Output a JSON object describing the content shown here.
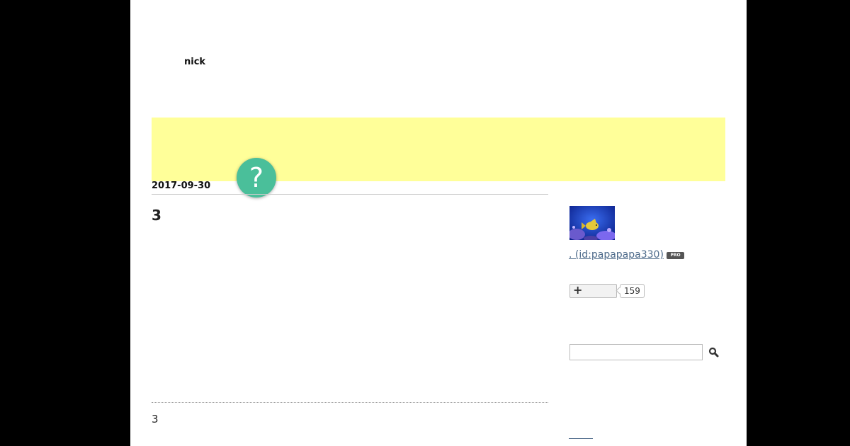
{
  "blog": {
    "title": "nick"
  },
  "help": {
    "glyph": "?"
  },
  "entry": {
    "date": "2017-09-30",
    "title": "3",
    "footer_text": "3"
  },
  "sidebar": {
    "profile": {
      "name_link": ". (id:papapapa330)",
      "badge": "PRO"
    },
    "follow": {
      "plus": "+",
      "count": "159"
    },
    "search": {
      "placeholder": ""
    }
  },
  "colors": {
    "banner": "#ffff99",
    "help_button": "#4abf9a",
    "link": "#4d6a8a",
    "frame": "#000000"
  }
}
